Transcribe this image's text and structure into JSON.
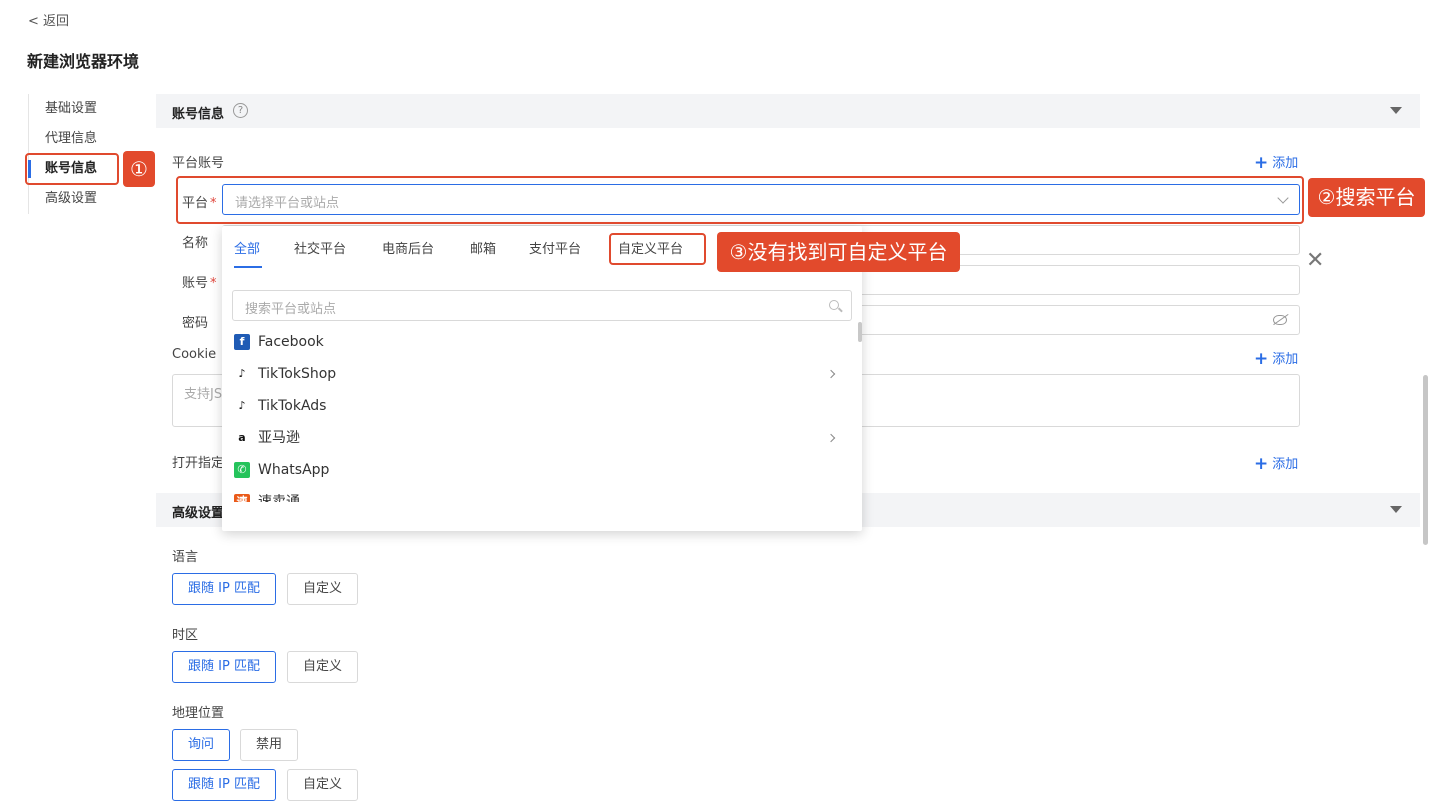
{
  "back": "< 返回",
  "page_title": "新建浏览器环境",
  "sidenav": [
    "基础设置",
    "代理信息",
    "账号信息",
    "高级设置"
  ],
  "account_section": {
    "title": "账号信息",
    "help": "?",
    "platform_account_label": "平台账号",
    "add": "添加",
    "platform_label": "平台",
    "platform_placeholder": "请选择平台或站点",
    "name_label": "名称",
    "account_label": "账号",
    "password_label": "密码",
    "cookie_label": "Cookie",
    "cookie_placeholder": "支持JS",
    "open_label": "打开指定"
  },
  "dropdown": {
    "tabs": [
      "全部",
      "社交平台",
      "电商后台",
      "邮箱",
      "支付平台",
      "自定义平台"
    ],
    "search_placeholder": "搜索平台或站点",
    "items": [
      {
        "icon": "f",
        "label": "Facebook"
      },
      {
        "icon": "♪",
        "label": "TikTokShop"
      },
      {
        "icon": "♪",
        "label": "TikTokAds"
      },
      {
        "icon": "a",
        "label": "亚马逊"
      },
      {
        "icon": "✆",
        "label": "WhatsApp"
      },
      {
        "icon": "速",
        "label": "速卖通"
      }
    ]
  },
  "advanced_section": {
    "title": "高级设置",
    "language_label": "语言",
    "timezone_label": "时区",
    "geo_label": "地理位置",
    "follow_ip": "跟随 IP 匹配",
    "custom": "自定义",
    "ask": "询问",
    "disable": "禁用"
  },
  "annotations": {
    "a1": "①",
    "a2": "②搜索平台",
    "a3": "③没有找到可自定义平台"
  },
  "colors": {
    "accent": "#2b6de5",
    "annotation": "#e24a2c"
  }
}
